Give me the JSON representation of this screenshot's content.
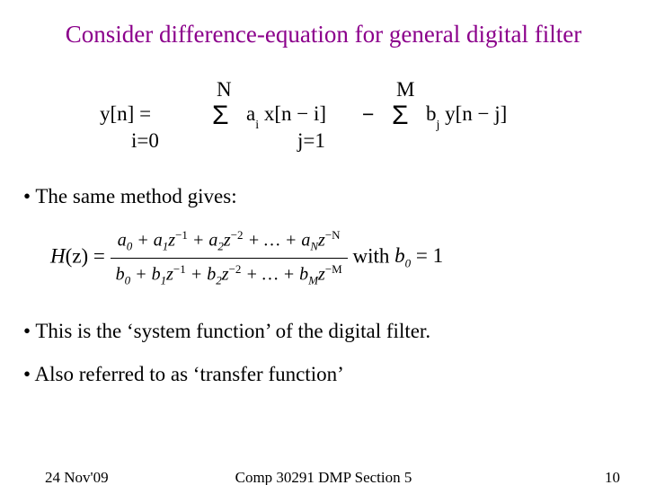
{
  "title": "Consider difference-equation for general digital filter",
  "eq1": {
    "lhs": "y[n]    =",
    "upper_N": "N",
    "sigma1": "Σ",
    "lower_i": "i=0",
    "term_a": "a",
    "term_asub": "i",
    "term_x": " x[n − i]",
    "minus": "−",
    "upper_M": "M",
    "sigma2": "Σ",
    "lower_j": "j=1",
    "term_b": "b",
    "term_bsub": "j",
    "term_y": " y[n − j]"
  },
  "bullet1": "• The same method gives:",
  "eq2": {
    "Hz_open": "H",
    "Hz_arg": "(z) = ",
    "num": {
      "a0": "a",
      "sub0": "0",
      "plus1": " + a",
      "sub1": "1",
      "z1": "z",
      "p1": "−1",
      "plus2": " + a",
      "sub2": "2",
      "z2": "z",
      "p2": "−2",
      "dots": " + … + a",
      "subN": "N",
      "zN": "z",
      "pN": "−N"
    },
    "den": {
      "b0": "b",
      "sub0": "0",
      "plus1": " + b",
      "sub1": "1",
      "z1": "z",
      "p1": "−1",
      "plus2": " + b",
      "sub2": "2",
      "z2": "z",
      "p2": "−2",
      "dots": " + … + b",
      "subM": "M",
      "zM": "z",
      "pM": "−M"
    },
    "with": "   with  ",
    "b0eq1_b": "b",
    "b0eq1_sub": "0",
    "b0eq1_eq": " = 1"
  },
  "bullet2": "• This is the ‘system function’ of the digital filter.",
  "bullet3": "• Also referred to as ‘transfer function’",
  "footer": {
    "left": "24 Nov'09",
    "center": "Comp 30291 DMP Section 5",
    "right": "10"
  }
}
